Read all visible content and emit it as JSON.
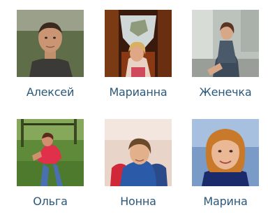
{
  "friends": [
    {
      "name": "Алексей"
    },
    {
      "name": "Марианна"
    },
    {
      "name": "Женечка"
    },
    {
      "name": "Ольга"
    },
    {
      "name": "Нонна"
    },
    {
      "name": "Марина"
    }
  ],
  "colors": {
    "link": "#2b587a",
    "background": "#ffffff"
  }
}
